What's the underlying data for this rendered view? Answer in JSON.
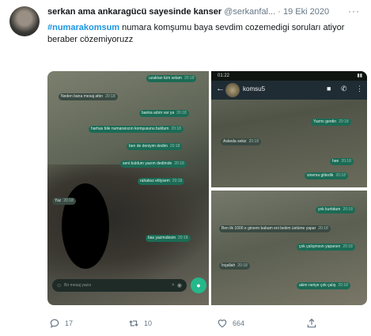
{
  "tweet": {
    "display_name": "serkan ama ankaragücü sayesinde kanser",
    "handle": "@serkanfal...",
    "separator": "·",
    "date": "19 Eki 2020",
    "more_label": "···",
    "hashtag": "#numarakomsum",
    "body": " numara komşumu baya sevdim cozemedigi soruları atiyor beraber cözemiyoruzz"
  },
  "left_chat": {
    "bubbles": [
      {
        "text": "uzaktan tüm selam",
        "time": "20:18",
        "dir": "out"
      },
      {
        "text": "Neden bana mesaj attın",
        "time": "20:18",
        "dir": "in"
      },
      {
        "text": "banka adım var ya",
        "time": "20:18",
        "dir": "out"
      },
      {
        "text": "harhas bile numaranızın komşusunu buldum",
        "time": "20:18",
        "dir": "out"
      },
      {
        "text": "ben de deniyim dedim",
        "time": "20:18",
        "dir": "out"
      },
      {
        "text": "seni buldum yazım dedimde",
        "time": "20:18",
        "dir": "out"
      },
      {
        "text": "rahatsız ettiysem",
        "time": "20:18",
        "dir": "out"
      },
      {
        "text": "Yaz",
        "time": "20:18",
        "dir": "in"
      },
      {
        "text": "bas yazmıdesm",
        "time": "20:18",
        "dir": "out"
      }
    ],
    "input_placeholder": "Bir mesaj yazın"
  },
  "right_top_chat": {
    "status_time": "01:22",
    "contact_name": "komsu5",
    "bubbles": [
      {
        "text": "Yazmı gerdin",
        "time": "20:18",
        "dir": "out"
      },
      {
        "text": "Askeda sekiz",
        "time": "20:18",
        "dir": "in"
      },
      {
        "text": "hee",
        "time": "20:18",
        "dir": "out"
      },
      {
        "text": "sinema gittedik",
        "time": "20:18",
        "dir": "out"
      }
    ]
  },
  "right_bottom_chat": {
    "bubbles": [
      {
        "text": "yok kurtidum",
        "time": "20:18",
        "dir": "out"
      },
      {
        "text": "Ben ilk 1000 e girsem babam eni bekim üstüme yapar",
        "time": "20:18",
        "dir": "in"
      },
      {
        "text": "çok çalışmısın yaparsın",
        "time": "20:18",
        "dir": "out"
      },
      {
        "text": "İnşallah",
        "time": "20:18",
        "dir": "in"
      },
      {
        "text": "akim neriye çok çalış",
        "time": "20:18",
        "dir": "out"
      }
    ]
  },
  "actions": {
    "replies": "17",
    "retweets": "10",
    "likes": "664"
  },
  "colors": {
    "hashtag": "#1b95e0",
    "secondary_text": "#657786",
    "bubble_out": "#1b6b55",
    "bubble_in": "#3a4a43",
    "mic_button": "#25b88a"
  },
  "icons": [
    "reply-icon",
    "retweet-icon",
    "like-icon",
    "share-icon",
    "back-arrow-icon",
    "video-call-icon",
    "phone-icon",
    "menu-dots-icon",
    "emoji-icon",
    "attach-icon",
    "camera-icon",
    "mic-icon"
  ]
}
